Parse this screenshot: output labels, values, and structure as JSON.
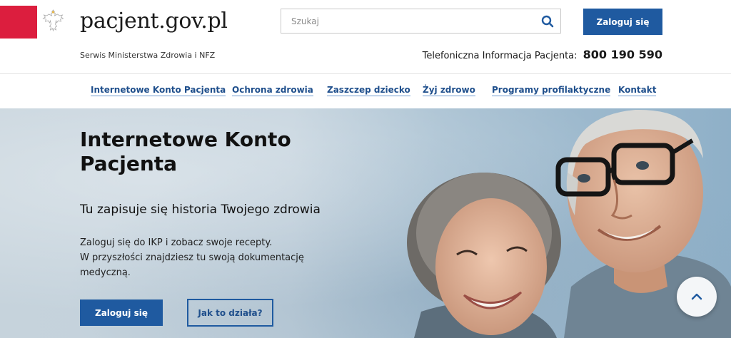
{
  "header": {
    "site_name": "pacjent.gov.pl",
    "subtitle": "Serwis Ministerstwa Zdrowia i NFZ",
    "search_placeholder": "Szukaj",
    "login_label": "Zaloguj się",
    "phone_label": "Telefoniczna Informacja Pacjenta:",
    "phone_number": "800 190 590",
    "emblem_icon": "polish-eagle-icon",
    "emblem_color": "#dc1e3e"
  },
  "nav": {
    "items": [
      {
        "label": "Internetowe Konto Pacjenta"
      },
      {
        "label": "Ochrona zdrowia"
      },
      {
        "label": "Zaszczep dziecko"
      },
      {
        "label": "Żyj zdrowo"
      },
      {
        "label": "Programy profilaktyczne"
      },
      {
        "label": "Kontakt"
      }
    ]
  },
  "hero": {
    "title": "Internetowe Konto Pacjenta",
    "lead": "Tu zapisuje się historia Twojego zdrowia",
    "body_lines": [
      "Zaloguj się do IKP i zobacz swoje recepty.",
      "W przyszłości znajdziesz tu swoją dokumentację",
      "medyczną."
    ],
    "login_label": "Zaloguj się",
    "how_label": "Jak to działa?",
    "photo": "senior-couple-photo"
  },
  "colors": {
    "brand_blue": "#1f5aa0",
    "link_blue": "#1f4f8c",
    "brand_red": "#dc1e3e"
  },
  "scroll_top_icon": "chevron-up-icon"
}
